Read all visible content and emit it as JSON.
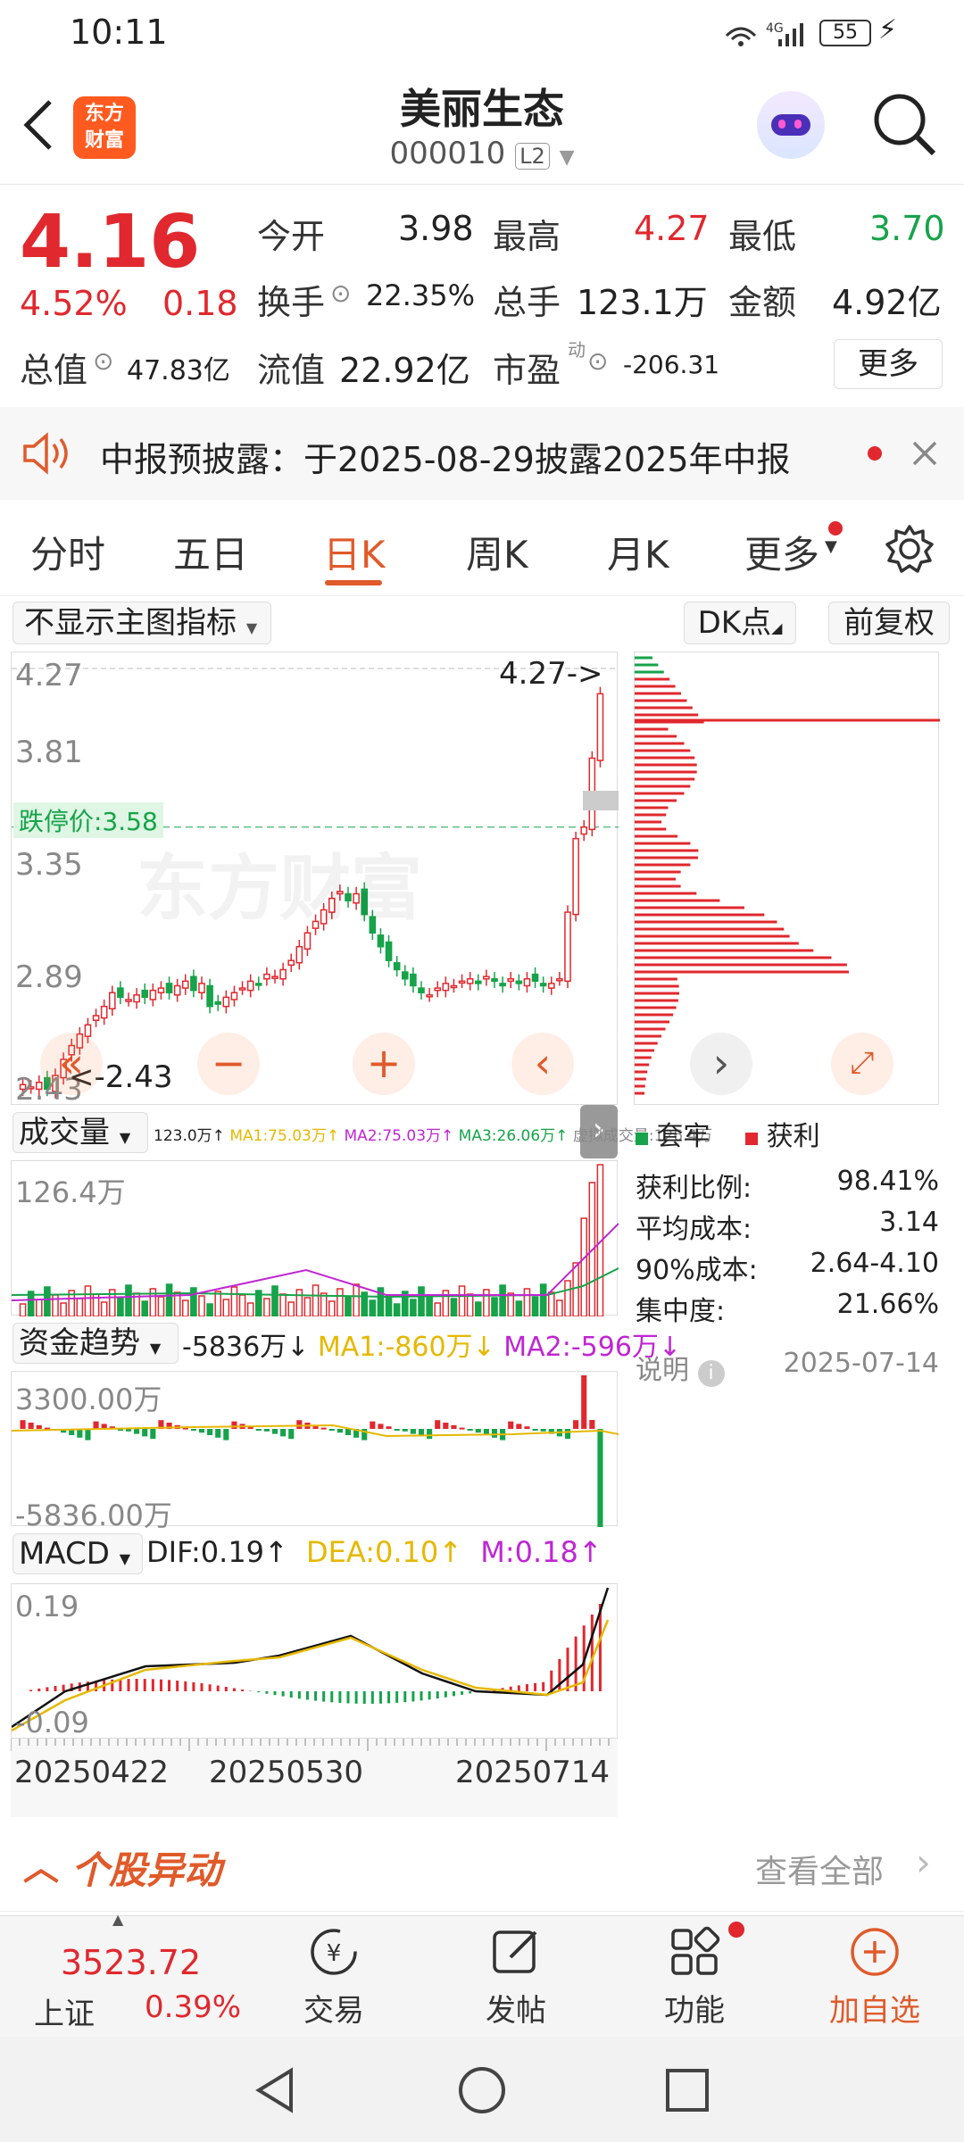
{
  "status": {
    "time": "10:11",
    "network": "4G",
    "battery": "55"
  },
  "header": {
    "title": "美丽生态",
    "code": "000010",
    "level": "L2",
    "logo_line1": "东方",
    "logo_line2": "财富"
  },
  "quote": {
    "price": "4.16",
    "change_pct": "4.52%",
    "change": "0.18",
    "open_label": "今开",
    "open": "3.98",
    "high_label": "最高",
    "high": "4.27",
    "low_label": "最低",
    "low": "3.70",
    "turnover_label": "换手",
    "turnover": "22.35%",
    "volume_label": "总手",
    "volume": "123.1万",
    "amount_label": "金额",
    "amount": "4.92亿",
    "total_mv_label": "总值",
    "total_mv": "47.83亿",
    "float_mv_label": "流值",
    "float_mv": "22.92亿",
    "pe_label": "市盈",
    "pe_sup": "动",
    "pe": "-206.31",
    "more": "更多"
  },
  "notice": {
    "text": "中报预披露：于2025-08-29披露2025年中报"
  },
  "tabs": [
    "分时",
    "五日",
    "日K",
    "周K",
    "月K",
    "更多"
  ],
  "tab_active": 2,
  "chart_controls": {
    "main_indicator": "不显示主图指标",
    "dk": "DK点",
    "adjust": "前复权"
  },
  "kline": {
    "y_labels": [
      "4.27",
      "3.81",
      "3.35",
      "2.89",
      "2.43"
    ],
    "limit_down_label": "跌停价:3.58",
    "max_marker": "4.27->",
    "min_marker": "<-2.43",
    "watermark": "东方财富"
  },
  "volume_panel": {
    "name": "成交量",
    "vol": "123.0万↑",
    "ma1": "MA1:75.03万↑",
    "ma2": "MA2:75.03万↑",
    "ma3": "MA3:26.06万↑",
    "virtual": "虚拟成交量:126.4万",
    "top": "126.4万"
  },
  "fund_panel": {
    "name": "资金趋势",
    "val": "-5836万↓",
    "ma1": "MA1:-860万↓",
    "ma2": "MA2:-596万↓",
    "top": "3300.00万",
    "bottom": "-5836.00万"
  },
  "macd_panel": {
    "name": "MACD",
    "dif": "DIF:0.19↑",
    "dea": "DEA:0.10↑",
    "m": "M:0.18↑",
    "top": "0.19",
    "bottom": "-0.09"
  },
  "dates": [
    "20250422",
    "20250530",
    "20250714"
  ],
  "chip": {
    "legend_loss": "套牢",
    "legend_profit": "获利",
    "rows": [
      {
        "label": "获利比例:",
        "value": "98.41%"
      },
      {
        "label": "平均成本:",
        "value": "3.14"
      },
      {
        "label": "90%成本:",
        "value": "2.64-4.10"
      },
      {
        "label": "集中度:",
        "value": "21.66%"
      }
    ],
    "note_label": "说明",
    "date": "2025-07-14"
  },
  "anomaly": {
    "title": "个股异动",
    "view_all": "查看全部"
  },
  "bottom_nav": {
    "index_value": "3523.72",
    "index_name": "上证",
    "index_change": "0.39%",
    "items": [
      "交易",
      "发帖",
      "功能",
      "加自选"
    ]
  },
  "colors": {
    "up": "#e0282e",
    "down": "#16a34a",
    "accent": "#ff6a1a"
  }
}
